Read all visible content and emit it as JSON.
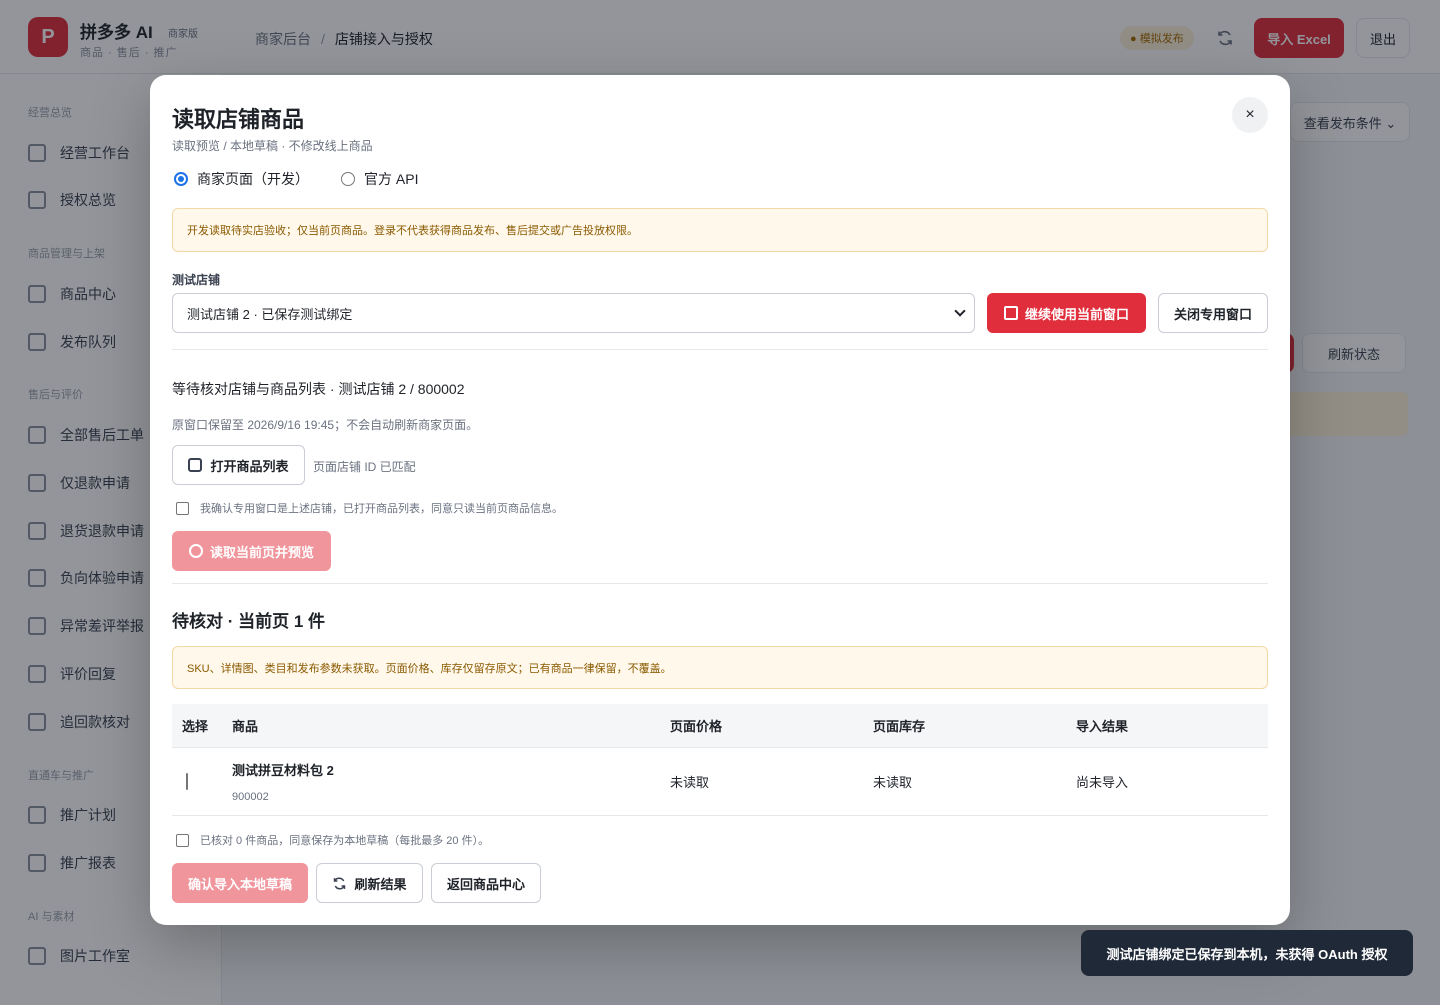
{
  "app": {
    "logo_letter": "P",
    "name": "拼多多 AI",
    "badge": "商家版",
    "subtitle": "商品 · 售后 · 推广",
    "breadcrumb": [
      "商家后台",
      "店铺接入与授权"
    ],
    "status_pill": "● 模拟发布",
    "import_excel": "导入 Excel",
    "logout": "退出",
    "accent": "#e02e3c"
  },
  "sidebar": {
    "groups": [
      {
        "label": "经营总览",
        "items": [
          "经营工作台",
          "授权总览"
        ]
      },
      {
        "label": "商品管理与上架",
        "items": [
          "商品中心",
          "发布队列"
        ]
      },
      {
        "label": "售后与评价",
        "items": [
          "全部售后工单",
          "仅退款申请",
          "退货退款申请",
          "负向体验申请",
          "异常差评举报",
          "评价回复",
          "追回款核对"
        ]
      },
      {
        "label": "直通车与推广",
        "items": [
          "推广计划",
          "推广报表"
        ]
      },
      {
        "label": "AI 与素材",
        "items": [
          "图片工作室"
        ]
      }
    ]
  },
  "background": {
    "filter_button": "查看发布条件 ⌄",
    "refresh_status": "刷新状态"
  },
  "modal": {
    "title": "读取店铺商品",
    "subtitle": "读取预览 / 本地草稿 · 不修改线上商品",
    "close_symbol": "×",
    "mode_options": [
      {
        "label": "商家页面（开发）",
        "selected": true
      },
      {
        "label": "官方 API",
        "selected": false
      }
    ],
    "notice": "开发读取待实店验收；仅当前页商品。登录不代表获得商品发布、售后提交或广告投放权限。",
    "store_label": "测试店铺",
    "store_select_value": "测试店铺 2 · 已保存测试绑定",
    "continue_window_button": "继续使用当前窗口",
    "close_window_button": "关闭专用窗口",
    "pending_title": "等待核对店铺与商品列表 · 测试店铺 2 / 800002",
    "keep_note": "原窗口保留至 2026/9/16 19:45；不会自动刷新商家页面。",
    "open_list_button": "打开商品列表",
    "match_status": "页面店铺 ID 已匹配",
    "confirm_window_check": "我确认专用窗口是上述店铺，已打开商品列表，同意只读当前页商品信息。",
    "read_preview_button": "读取当前页并预览",
    "review_title": "待核对 · 当前页 1 件",
    "review_notice": "SKU、详情图、类目和发布参数未获取。页面价格、库存仅留存原文；已有商品一律保留，不覆盖。",
    "table": {
      "headers": [
        "选择",
        "商品",
        "页面价格",
        "页面库存",
        "导入结果"
      ],
      "rows": [
        {
          "name": "测试拼豆材料包 2",
          "id": "900002",
          "price": "未读取",
          "stock": "未读取",
          "result": "尚未导入"
        }
      ]
    },
    "save_check": "已核对 0 件商品，同意保存为本地草稿（每批最多 20 件）。",
    "confirm_import_button": "确认导入本地草稿",
    "refresh_result_button": "刷新结果",
    "back_button": "返回商品中心"
  },
  "toast": "测试店铺绑定已保存到本机，未获得 OAuth 授权"
}
